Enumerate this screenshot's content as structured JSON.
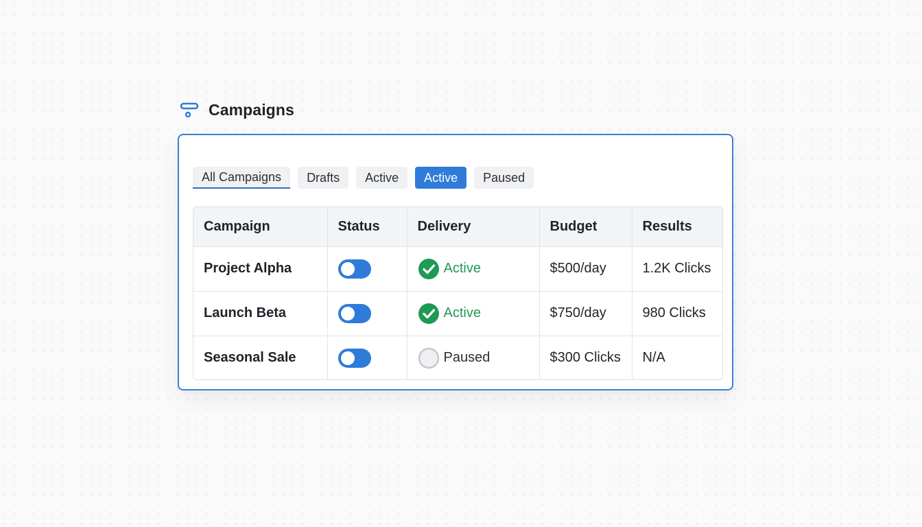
{
  "header": {
    "title": "Campaigns",
    "icon": "filter-icon"
  },
  "tabs": [
    {
      "label": "All Campaigns"
    },
    {
      "label": "Drafts"
    },
    {
      "label": "Active"
    },
    {
      "label": "Active",
      "selected": true
    },
    {
      "label": "Paused"
    }
  ],
  "table": {
    "columns": [
      "Campaign",
      "Status",
      "Delivery",
      "Budget",
      "Results"
    ],
    "rows": [
      {
        "campaign": "Project Alpha",
        "status_on": true,
        "delivery": "Active",
        "delivery_state": "active",
        "budget": "$500/day",
        "results": "1.2K Clicks"
      },
      {
        "campaign": "Launch Beta",
        "status_on": true,
        "delivery": "Active",
        "delivery_state": "active",
        "budget": "$750/day",
        "results": "980 Clicks"
      },
      {
        "campaign": "Seasonal Sale",
        "status_on": true,
        "delivery": "Paused",
        "delivery_state": "paused",
        "budget": "$300 Clicks",
        "results": "N/A"
      }
    ]
  },
  "colors": {
    "accent": "#2f7bd9",
    "success": "#1f9a55",
    "panel_border": "#3a82d4"
  }
}
